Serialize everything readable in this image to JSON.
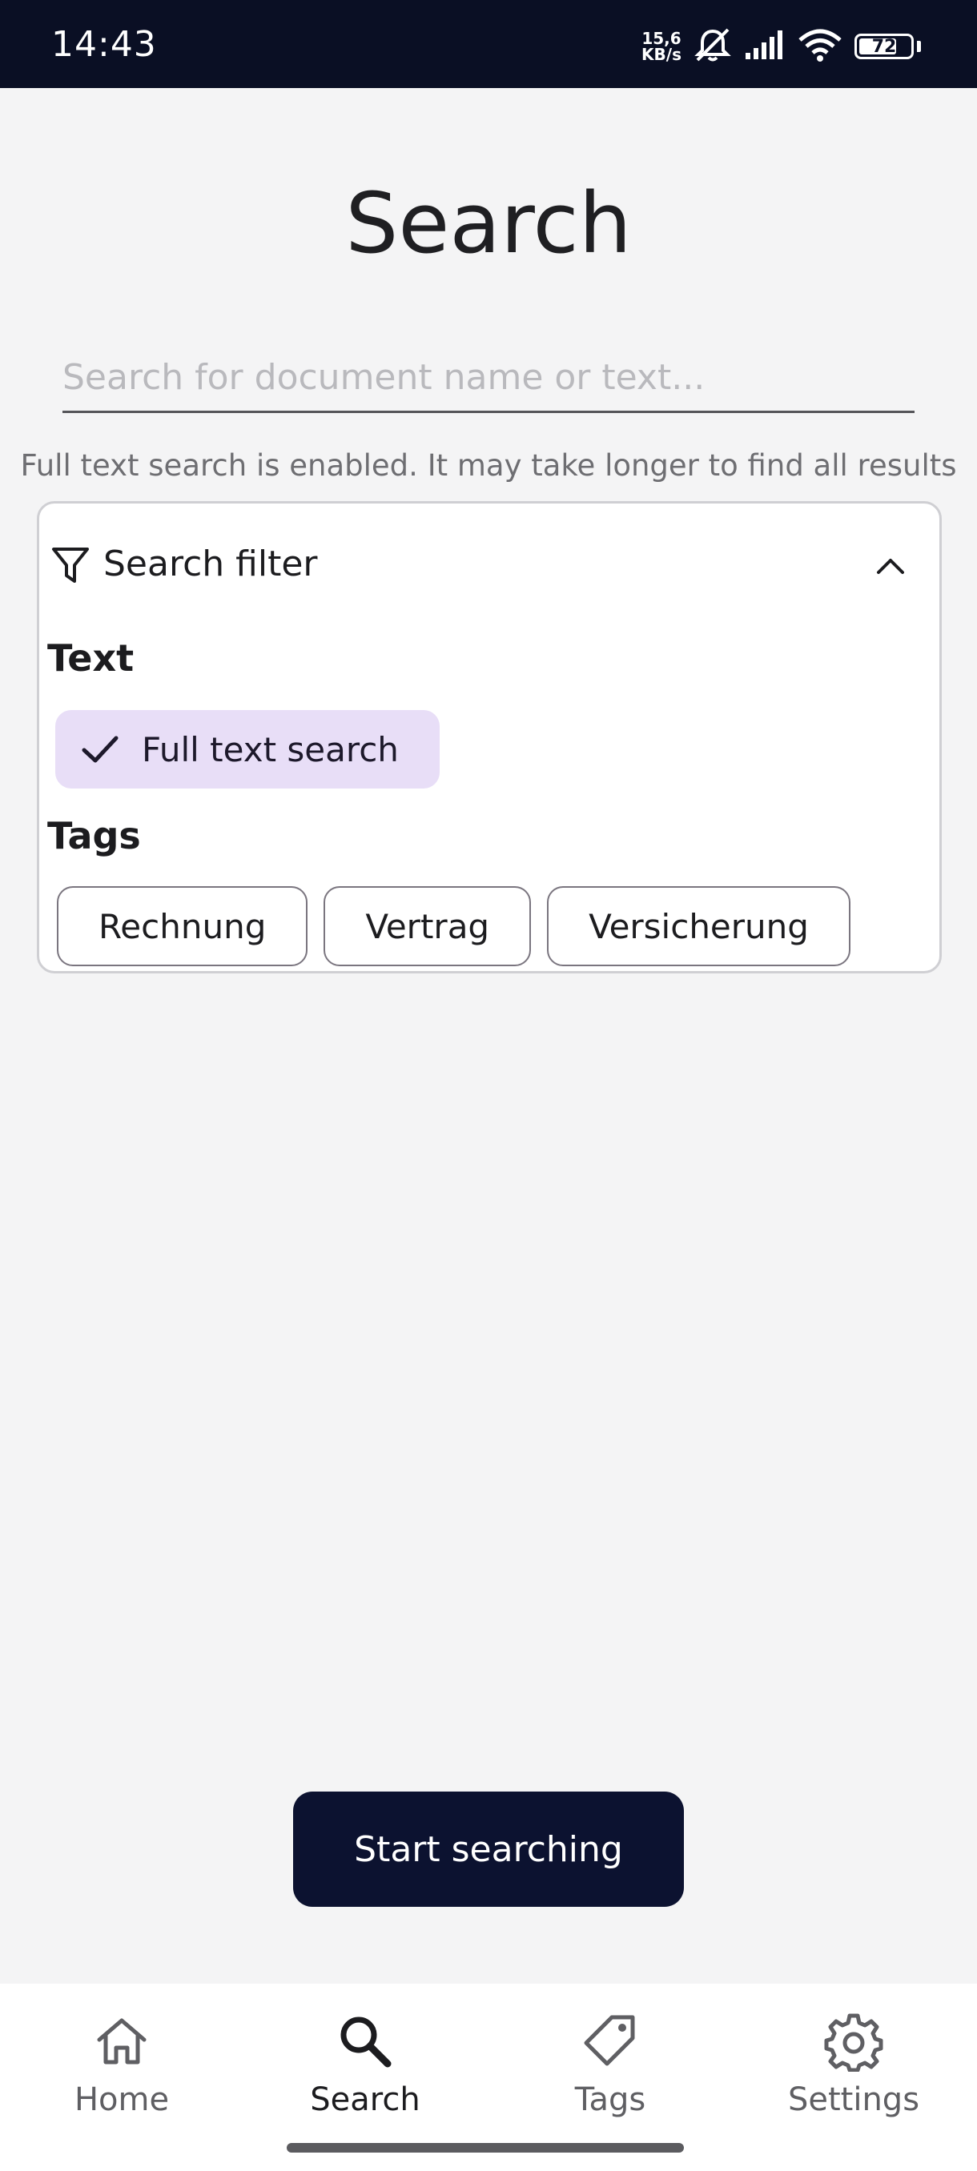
{
  "status_bar": {
    "time": "14:43",
    "net_speed_value": "15,6",
    "net_speed_unit": "KB/s",
    "battery_level": "72",
    "icons": [
      "mute-icon",
      "signal-icon",
      "wifi-icon",
      "battery-icon"
    ]
  },
  "page": {
    "title": "Search"
  },
  "search": {
    "placeholder": "Search for document name or text...",
    "value": "",
    "hint": "Full text search is enabled. It may take longer to find all results"
  },
  "filter": {
    "title": "Search filter",
    "expanded": true,
    "text_section_label": "Text",
    "full_text_chip": {
      "label": "Full text search",
      "selected": true
    },
    "tags_section_label": "Tags",
    "tags": [
      {
        "label": "Rechnung",
        "selected": false
      },
      {
        "label": "Vertrag",
        "selected": false
      },
      {
        "label": "Versicherung",
        "selected": false
      }
    ]
  },
  "actions": {
    "start_label": "Start searching"
  },
  "bottom_nav": {
    "items": [
      {
        "label": "Home",
        "icon": "home-icon",
        "active": false
      },
      {
        "label": "Search",
        "icon": "search-icon",
        "active": true
      },
      {
        "label": "Tags",
        "icon": "tag-icon",
        "active": false
      },
      {
        "label": "Settings",
        "icon": "settings-icon",
        "active": false
      }
    ]
  },
  "colors": {
    "status_bar_bg": "#0a0f24",
    "primary_button_bg": "#0c1230",
    "selected_chip_bg": "#e8def7",
    "background": "#f4f4f5"
  }
}
